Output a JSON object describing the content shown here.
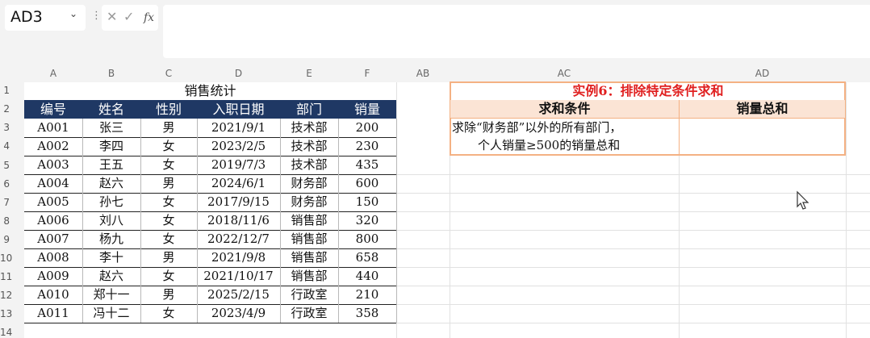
{
  "name_box": {
    "value": "AD3"
  },
  "formula_bar": {
    "value": "",
    "cancel_glyph": "✕",
    "enter_glyph": "✓",
    "fx_label": "fx"
  },
  "columns": [
    "A",
    "B",
    "C",
    "D",
    "E",
    "F",
    "AB",
    "AC",
    "AD"
  ],
  "rows": [
    "1",
    "2",
    "3",
    "4",
    "5",
    "6",
    "7",
    "8",
    "9",
    "10",
    "11",
    "12",
    "13",
    "14"
  ],
  "left_table": {
    "title": "销售统计",
    "headers": [
      "编号",
      "姓名",
      "性别",
      "入职日期",
      "部门",
      "销量"
    ],
    "rows": [
      [
        "A001",
        "张三",
        "男",
        "2021/9/1",
        "技术部",
        "200"
      ],
      [
        "A002",
        "李四",
        "女",
        "2023/2/5",
        "技术部",
        "230"
      ],
      [
        "A003",
        "王五",
        "女",
        "2019/7/3",
        "技术部",
        "435"
      ],
      [
        "A004",
        "赵六",
        "男",
        "2024/6/1",
        "财务部",
        "600"
      ],
      [
        "A005",
        "孙七",
        "女",
        "2017/9/15",
        "财务部",
        "150"
      ],
      [
        "A006",
        "刘八",
        "女",
        "2018/11/6",
        "销售部",
        "320"
      ],
      [
        "A007",
        "杨九",
        "女",
        "2022/12/7",
        "销售部",
        "800"
      ],
      [
        "A008",
        "李十",
        "男",
        "2021/9/8",
        "销售部",
        "658"
      ],
      [
        "A009",
        "赵六",
        "女",
        "2021/10/17",
        "销售部",
        "440"
      ],
      [
        "A010",
        "郑十一",
        "男",
        "2025/2/15",
        "行政室",
        "210"
      ],
      [
        "A011",
        "冯十二",
        "女",
        "2023/4/9",
        "行政室",
        "358"
      ]
    ],
    "header_color": "#1f3864"
  },
  "right_table": {
    "title": "实例6：排除特定条件求和",
    "col1_header": "求和条件",
    "col2_header": "销量总和",
    "cond_line1": "求除“财务部”以外的所有部门，",
    "cond_line2": "个人销量≥500的销量总和",
    "result": "",
    "title_color": "#e02020",
    "header_bg": "#fbe4d5",
    "border_color": "#f4b183"
  }
}
